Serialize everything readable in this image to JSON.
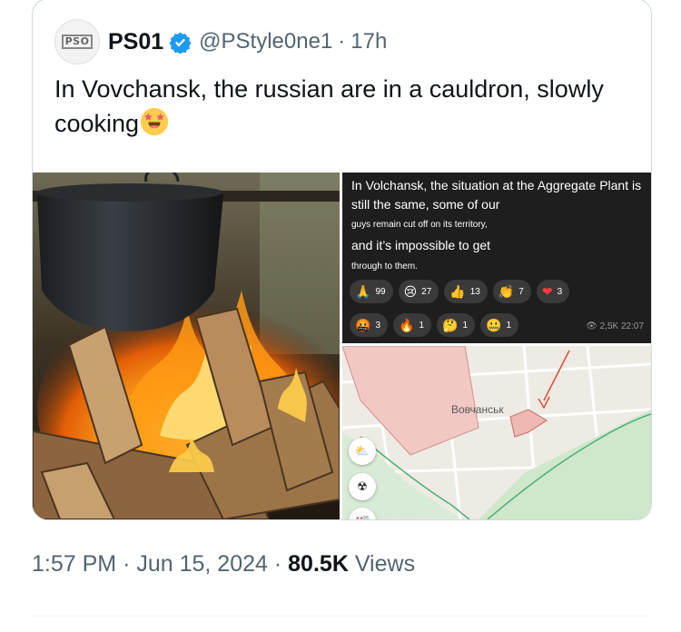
{
  "author": {
    "name": "PS01",
    "handle": "@PStyle0ne1",
    "time": "17h",
    "avatar_text": "PSO"
  },
  "tweet": {
    "text": "In Vovchansk, the russian are in a cauldron, slowly cooking",
    "emoji": "star-struck-emoji"
  },
  "media": {
    "left_image": "cauldron-over-fire-photo",
    "telegram": {
      "line1": "In Volchansk, the situation at the Aggregate Plant is still the same, some of our",
      "line2": "guys remain cut off on its territory,",
      "line3": "and it’s impossible to get",
      "line4": "through to them.",
      "reactions_row1": [
        {
          "icon": "🙏",
          "count": "99"
        },
        {
          "icon": "😢",
          "count": "27"
        },
        {
          "icon": "👍",
          "count": "13"
        },
        {
          "icon": "👏",
          "count": "7"
        },
        {
          "icon": "❤",
          "count": "3"
        }
      ],
      "reactions_row2": [
        {
          "icon": "🤬",
          "count": "3"
        },
        {
          "icon": "🔥",
          "count": "1"
        },
        {
          "icon": "🤔",
          "count": "1"
        },
        {
          "icon": "🤐",
          "count": "1"
        }
      ],
      "views_time": "2,5K 22:07"
    },
    "map": {
      "label": "Вовчанськ"
    }
  },
  "footer": {
    "time": "1:57 PM",
    "sep1": "·",
    "date": "Jun 15, 2024",
    "sep2": "·",
    "views_count": "80.5K",
    "views_label": "Views"
  },
  "colors": {
    "verified": "#1d9bf0",
    "secondary_text": "#536471",
    "border": "#cfd9de"
  }
}
